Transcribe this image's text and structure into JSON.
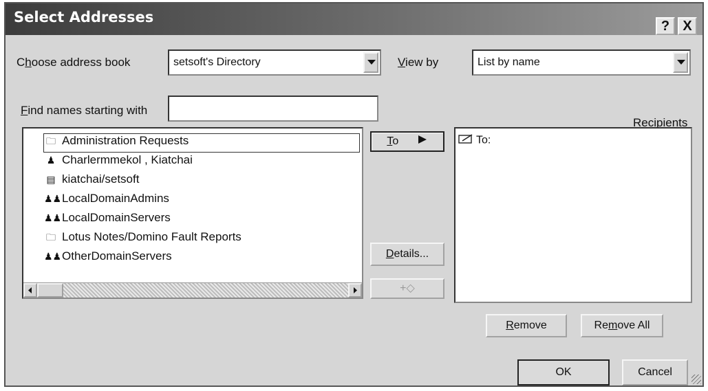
{
  "window": {
    "title": "Select Addresses",
    "help_glyph": "?",
    "close_glyph": "X"
  },
  "address_book": {
    "label_prefix": "C",
    "label_access": "h",
    "label_rest": "oose address book",
    "value": "setsoft's Directory"
  },
  "view_by": {
    "label_access": "V",
    "label_rest": "iew by",
    "value": "List by name"
  },
  "find": {
    "label_access": "F",
    "label_rest": "ind names starting with",
    "value": ""
  },
  "names_list": {
    "items": [
      {
        "icon": "folder-icon",
        "glyph": "🗀",
        "label": "Administration Requests",
        "selected": true
      },
      {
        "icon": "person-icon",
        "glyph": "♟",
        "label": "Charlermmekol , Kiatchai",
        "selected": false
      },
      {
        "icon": "server-icon",
        "glyph": "▤",
        "label": "kiatchai/setsoft",
        "selected": false
      },
      {
        "icon": "group-icon",
        "glyph": "♟♟",
        "label": "LocalDomainAdmins",
        "selected": false
      },
      {
        "icon": "group-icon",
        "glyph": "♟♟",
        "label": "LocalDomainServers",
        "selected": false
      },
      {
        "icon": "folder-icon",
        "glyph": "🗀",
        "label": "Lotus Notes/Domino Fault Reports",
        "selected": false
      },
      {
        "icon": "group-icon",
        "glyph": "♟♟",
        "label": "OtherDomainServers",
        "selected": false
      }
    ]
  },
  "buttons": {
    "to_access": "T",
    "to_rest": "o",
    "details_access": "D",
    "details_rest": "etails...",
    "add_group_glyph": "+◇",
    "remove_access": "R",
    "remove_rest": "emove",
    "remove_all_prefix": "Re",
    "remove_all_access": "m",
    "remove_all_rest": "ove All",
    "ok": "OK",
    "cancel": "Cancel"
  },
  "recipients": {
    "label_access": "R",
    "label_rest": "ecipients",
    "entries": [
      {
        "icon": "memo-icon",
        "label": "To:"
      }
    ]
  },
  "colors": {
    "dialog_bg": "#d6d6d6",
    "titlebar": "#3c3c3c"
  }
}
